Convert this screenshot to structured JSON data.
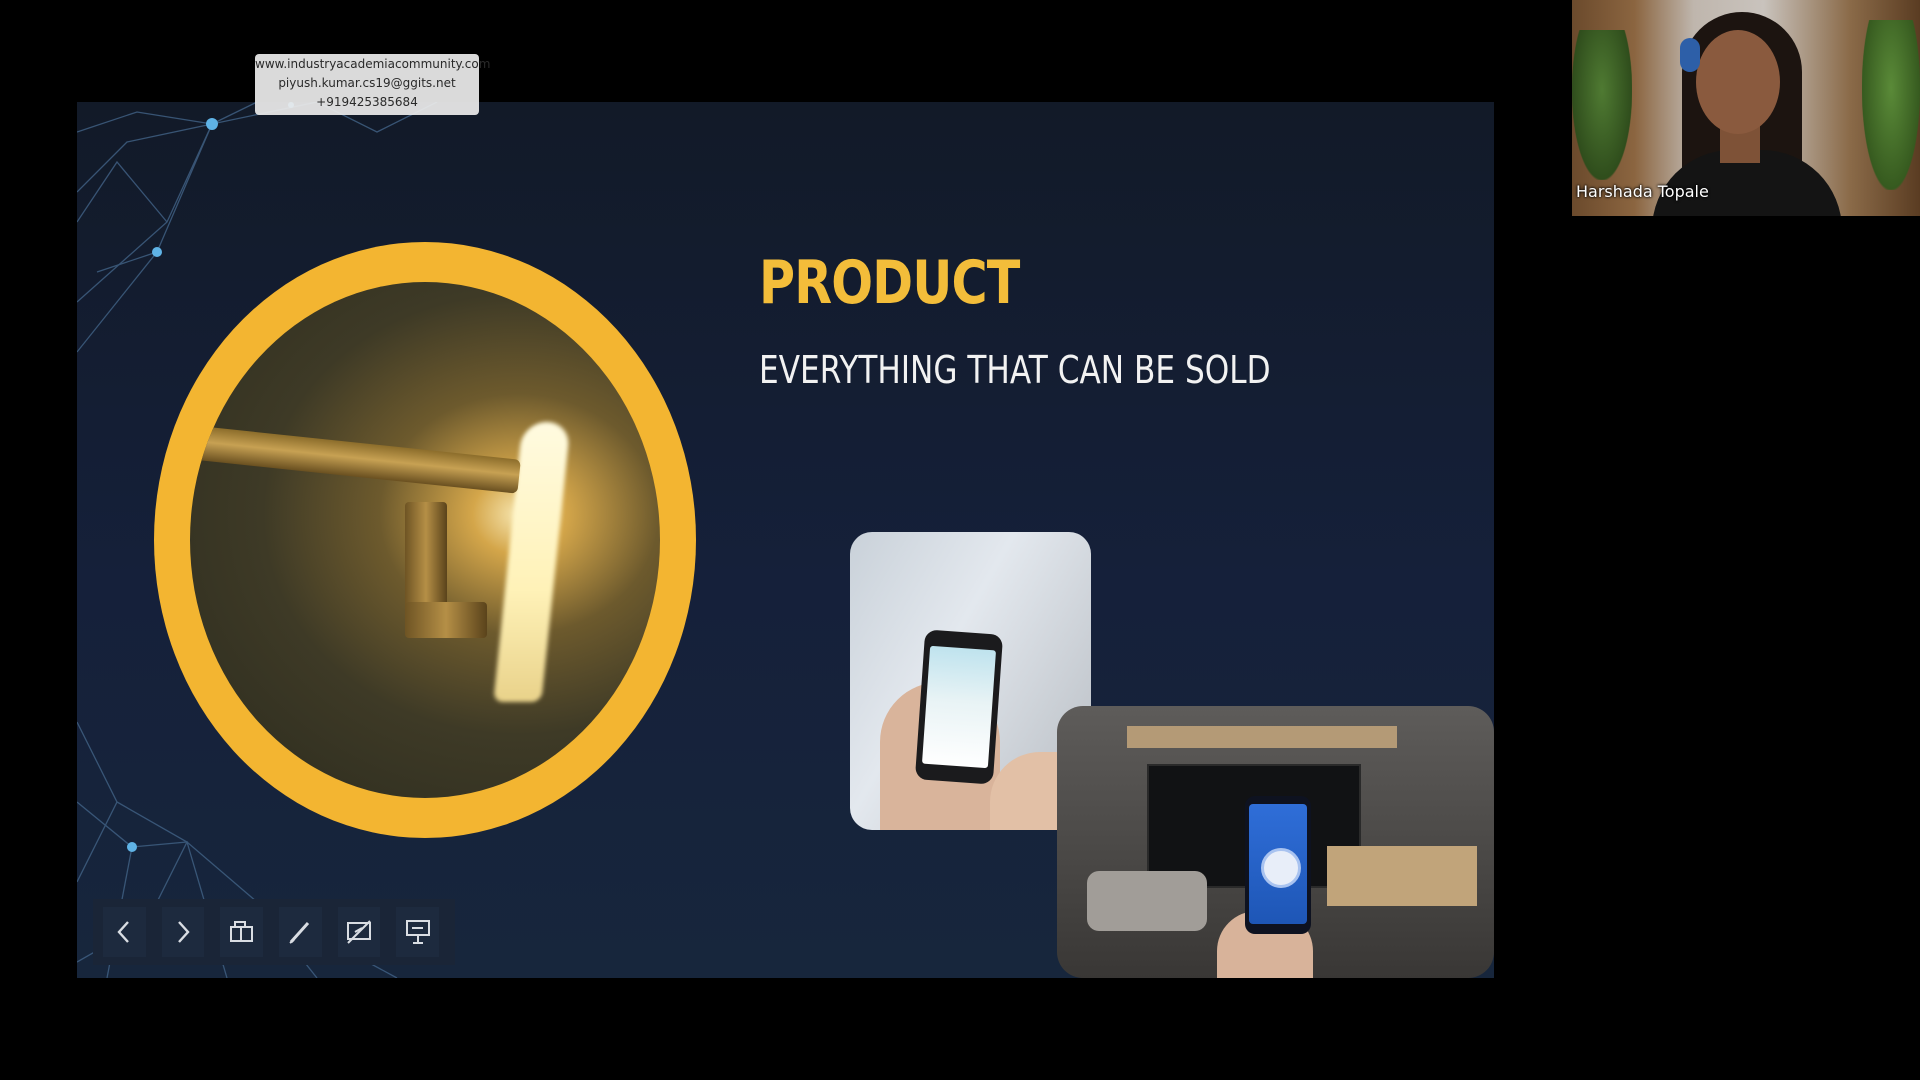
{
  "watermark": {
    "website": "www.industryacademiacommunity.com",
    "email": "piyush.kumar.cs19@ggits.net",
    "phone": "+919425385684"
  },
  "slide": {
    "title": "PRODUCT",
    "subtitle": "EVERYTHING THAT CAN BE SOLD",
    "colors": {
      "title": "#f3bd3a",
      "ring": "#f3b531",
      "background": "#121a28"
    }
  },
  "toolbar": {
    "buttons": [
      {
        "icon": "chevron-left-icon"
      },
      {
        "icon": "chevron-right-icon"
      },
      {
        "icon": "slides-overview-icon"
      },
      {
        "icon": "pen-icon"
      },
      {
        "icon": "annotation-off-icon"
      },
      {
        "icon": "presenter-view-icon"
      }
    ]
  },
  "participant": {
    "name": "Harshada Topale"
  }
}
